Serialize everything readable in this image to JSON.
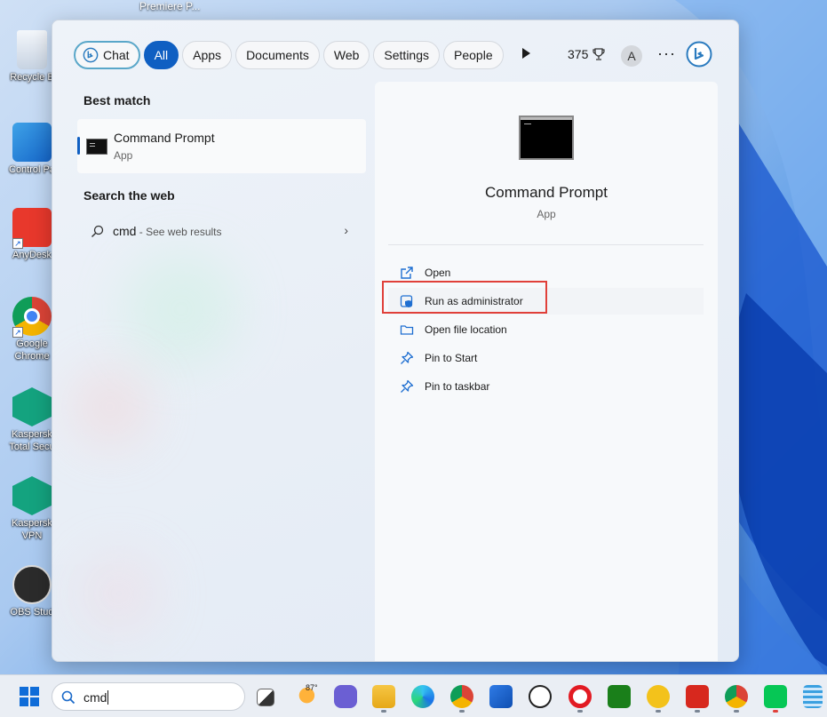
{
  "desktop": {
    "top_label": "Premiere P...",
    "icons": [
      {
        "label_lines": [
          "Recycle B"
        ]
      },
      {
        "label_lines": [
          "Control Pa"
        ]
      },
      {
        "label_lines": [
          "AnyDesk"
        ]
      },
      {
        "label_lines": [
          "Google",
          "Chrome"
        ]
      },
      {
        "label_lines": [
          "Kaspersk",
          "Total Secu"
        ]
      },
      {
        "label_lines": [
          "Kaspersk",
          "VPN"
        ]
      },
      {
        "label_lines": [
          "OBS Stud"
        ]
      }
    ]
  },
  "filters": {
    "chat": "Chat",
    "all": "All",
    "apps": "Apps",
    "documents": "Documents",
    "web": "Web",
    "settings": "Settings",
    "people": "People",
    "points": "375",
    "avatar_initial": "A",
    "more": "···"
  },
  "best_match": {
    "heading": "Best match",
    "title": "Command Prompt",
    "subtitle": "App"
  },
  "search_web": {
    "heading": "Search the web",
    "query": "cmd",
    "suffix": " - See web results"
  },
  "preview": {
    "title": "Command Prompt",
    "subtitle": "App",
    "actions": [
      {
        "label": "Open",
        "icon": "open-external-icon"
      },
      {
        "label": "Run as administrator",
        "icon": "shield-admin-icon"
      },
      {
        "label": "Open file location",
        "icon": "folder-icon"
      },
      {
        "label": "Pin to Start",
        "icon": "pin-icon"
      },
      {
        "label": "Pin to taskbar",
        "icon": "pin-icon"
      }
    ]
  },
  "taskbar": {
    "search_value": "cmd",
    "weather_temp": "87°"
  },
  "colors": {
    "accent": "#0f5fc2",
    "highlight_box": "#e0403a"
  }
}
